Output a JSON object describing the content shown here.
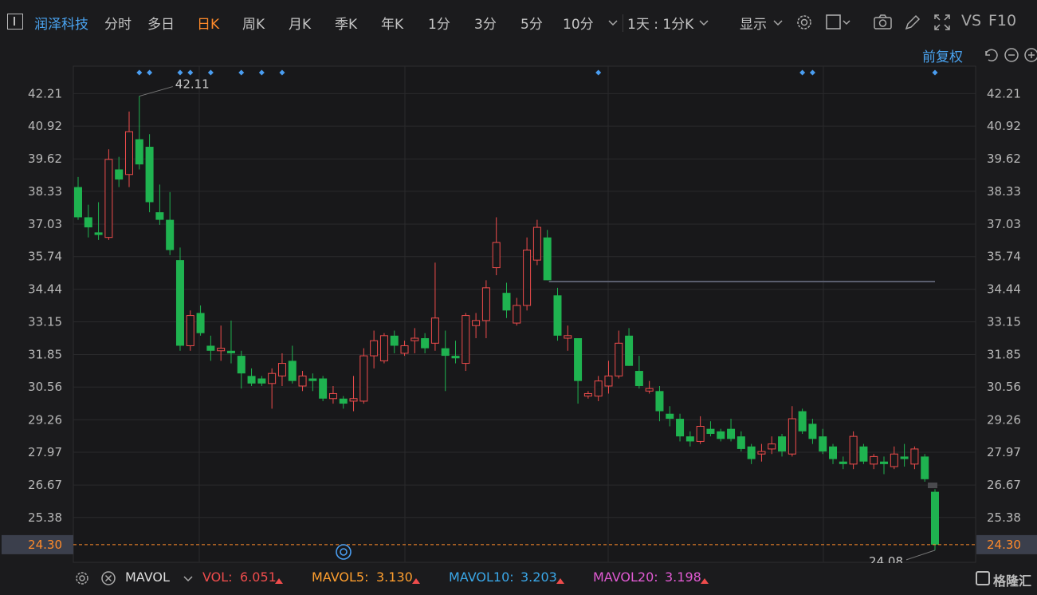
{
  "toolbar": {
    "stock_name": "润泽科技",
    "periods": [
      "分时",
      "多日",
      "日K",
      "周K",
      "月K",
      "季K",
      "年K",
      "1分",
      "3分",
      "5分",
      "10分"
    ],
    "active_period": "日K",
    "interval_select": "1天 : 1分K",
    "display_label": "显示",
    "vs_label": "VS",
    "f10_label": "F10"
  },
  "adjust_label": "前复权",
  "price_highlight_color": "#ff8a2a",
  "up_color": "#ef4c4c",
  "down_color": "#1fb350",
  "chart_data": {
    "type": "candlestick",
    "y_ticks": [
      "42.21",
      "40.92",
      "39.62",
      "38.33",
      "37.03",
      "35.74",
      "34.44",
      "33.15",
      "31.85",
      "30.56",
      "29.26",
      "27.97",
      "26.67",
      "25.38"
    ],
    "ylim": [
      23.6,
      43.3
    ],
    "current_price": "24.30",
    "high_label": "42.11",
    "low_label": "24.08",
    "resistance_level": 34.75,
    "marker_indices": [
      6,
      7,
      10,
      11,
      13,
      16,
      18,
      20,
      51,
      71,
      72,
      84
    ],
    "candles": [
      {
        "o": 38.5,
        "h": 38.9,
        "l": 37.2,
        "c": 37.3
      },
      {
        "o": 37.3,
        "h": 37.8,
        "l": 36.5,
        "c": 36.9
      },
      {
        "o": 36.7,
        "h": 37.9,
        "l": 36.4,
        "c": 36.6
      },
      {
        "o": 36.5,
        "h": 40.0,
        "l": 36.4,
        "c": 39.6
      },
      {
        "o": 39.2,
        "h": 39.7,
        "l": 38.5,
        "c": 38.8
      },
      {
        "o": 39.0,
        "h": 41.5,
        "l": 38.5,
        "c": 40.7
      },
      {
        "o": 40.4,
        "h": 42.11,
        "l": 39.2,
        "c": 39.4
      },
      {
        "o": 40.1,
        "h": 40.6,
        "l": 37.5,
        "c": 37.9
      },
      {
        "o": 37.5,
        "h": 38.6,
        "l": 37.0,
        "c": 37.2
      },
      {
        "o": 37.2,
        "h": 38.3,
        "l": 35.8,
        "c": 36.0
      },
      {
        "o": 35.6,
        "h": 36.1,
        "l": 32.0,
        "c": 32.2
      },
      {
        "o": 32.2,
        "h": 33.6,
        "l": 32.0,
        "c": 33.4
      },
      {
        "o": 33.5,
        "h": 33.8,
        "l": 32.6,
        "c": 32.7
      },
      {
        "o": 32.2,
        "h": 32.6,
        "l": 31.6,
        "c": 32.0
      },
      {
        "o": 32.0,
        "h": 33.0,
        "l": 31.6,
        "c": 32.1
      },
      {
        "o": 32.0,
        "h": 33.2,
        "l": 31.5,
        "c": 31.9
      },
      {
        "o": 31.8,
        "h": 32.0,
        "l": 30.5,
        "c": 31.1
      },
      {
        "o": 31.0,
        "h": 31.3,
        "l": 30.6,
        "c": 30.7
      },
      {
        "o": 30.9,
        "h": 31.0,
        "l": 30.6,
        "c": 30.7
      },
      {
        "o": 30.7,
        "h": 31.3,
        "l": 29.7,
        "c": 31.1
      },
      {
        "o": 31.0,
        "h": 31.9,
        "l": 30.6,
        "c": 31.5
      },
      {
        "o": 31.6,
        "h": 32.2,
        "l": 30.7,
        "c": 30.8
      },
      {
        "o": 30.6,
        "h": 31.2,
        "l": 30.4,
        "c": 31.0
      },
      {
        "o": 30.9,
        "h": 31.1,
        "l": 30.4,
        "c": 30.8
      },
      {
        "o": 30.9,
        "h": 31.0,
        "l": 30.0,
        "c": 30.1
      },
      {
        "o": 30.1,
        "h": 30.6,
        "l": 29.9,
        "c": 30.3
      },
      {
        "o": 30.1,
        "h": 30.2,
        "l": 29.7,
        "c": 29.9
      },
      {
        "o": 30.0,
        "h": 31.0,
        "l": 29.6,
        "c": 30.1
      },
      {
        "o": 30.0,
        "h": 32.1,
        "l": 29.9,
        "c": 31.8
      },
      {
        "o": 31.8,
        "h": 32.8,
        "l": 31.3,
        "c": 32.4
      },
      {
        "o": 31.6,
        "h": 32.7,
        "l": 31.5,
        "c": 32.6
      },
      {
        "o": 32.6,
        "h": 32.8,
        "l": 31.9,
        "c": 32.2
      },
      {
        "o": 31.9,
        "h": 32.4,
        "l": 31.8,
        "c": 32.2
      },
      {
        "o": 32.4,
        "h": 32.9,
        "l": 31.9,
        "c": 32.5
      },
      {
        "o": 32.5,
        "h": 32.7,
        "l": 31.9,
        "c": 32.1
      },
      {
        "o": 32.3,
        "h": 35.5,
        "l": 32.0,
        "c": 33.3
      },
      {
        "o": 32.1,
        "h": 32.8,
        "l": 30.4,
        "c": 31.8
      },
      {
        "o": 31.8,
        "h": 32.4,
        "l": 31.5,
        "c": 31.7
      },
      {
        "o": 31.5,
        "h": 33.5,
        "l": 31.2,
        "c": 33.4
      },
      {
        "o": 33.0,
        "h": 33.5,
        "l": 32.5,
        "c": 33.2
      },
      {
        "o": 33.2,
        "h": 34.8,
        "l": 32.5,
        "c": 34.5
      },
      {
        "o": 35.3,
        "h": 37.3,
        "l": 35.0,
        "c": 36.3
      },
      {
        "o": 34.3,
        "h": 34.7,
        "l": 33.3,
        "c": 33.6
      },
      {
        "o": 33.1,
        "h": 34.1,
        "l": 33.0,
        "c": 33.8
      },
      {
        "o": 33.8,
        "h": 36.5,
        "l": 33.6,
        "c": 36.0
      },
      {
        "o": 35.6,
        "h": 37.2,
        "l": 35.4,
        "c": 36.9
      },
      {
        "o": 36.5,
        "h": 36.8,
        "l": 34.8,
        "c": 34.8
      },
      {
        "o": 34.2,
        "h": 34.5,
        "l": 32.4,
        "c": 32.6
      },
      {
        "o": 32.5,
        "h": 33.0,
        "l": 32.0,
        "c": 32.6
      },
      {
        "o": 32.5,
        "h": 32.5,
        "l": 29.9,
        "c": 30.8
      },
      {
        "o": 30.2,
        "h": 30.4,
        "l": 30.1,
        "c": 30.3
      },
      {
        "o": 30.2,
        "h": 31.0,
        "l": 30.0,
        "c": 30.8
      },
      {
        "o": 30.6,
        "h": 31.6,
        "l": 30.3,
        "c": 31.0
      },
      {
        "o": 31.0,
        "h": 32.8,
        "l": 30.9,
        "c": 32.3
      },
      {
        "o": 32.6,
        "h": 32.9,
        "l": 31.4,
        "c": 31.4
      },
      {
        "o": 31.2,
        "h": 31.8,
        "l": 30.5,
        "c": 30.6
      },
      {
        "o": 30.4,
        "h": 30.8,
        "l": 30.3,
        "c": 30.5
      },
      {
        "o": 30.4,
        "h": 30.6,
        "l": 29.2,
        "c": 29.6
      },
      {
        "o": 29.5,
        "h": 29.8,
        "l": 29.0,
        "c": 29.3
      },
      {
        "o": 29.3,
        "h": 29.5,
        "l": 28.4,
        "c": 28.6
      },
      {
        "o": 28.6,
        "h": 28.8,
        "l": 28.2,
        "c": 28.4
      },
      {
        "o": 28.4,
        "h": 29.4,
        "l": 28.3,
        "c": 29.0
      },
      {
        "o": 28.9,
        "h": 29.2,
        "l": 28.6,
        "c": 28.7
      },
      {
        "o": 28.8,
        "h": 28.9,
        "l": 28.4,
        "c": 28.5
      },
      {
        "o": 28.9,
        "h": 29.3,
        "l": 28.4,
        "c": 28.5
      },
      {
        "o": 28.6,
        "h": 28.8,
        "l": 28.0,
        "c": 28.1
      },
      {
        "o": 28.2,
        "h": 28.3,
        "l": 27.5,
        "c": 27.7
      },
      {
        "o": 27.9,
        "h": 28.3,
        "l": 27.6,
        "c": 28.0
      },
      {
        "o": 28.1,
        "h": 28.6,
        "l": 27.9,
        "c": 28.3
      },
      {
        "o": 28.6,
        "h": 28.7,
        "l": 27.8,
        "c": 28.0
      },
      {
        "o": 27.9,
        "h": 29.8,
        "l": 27.8,
        "c": 29.3
      },
      {
        "o": 29.6,
        "h": 29.7,
        "l": 28.7,
        "c": 28.8
      },
      {
        "o": 29.1,
        "h": 29.3,
        "l": 28.3,
        "c": 28.5
      },
      {
        "o": 28.6,
        "h": 28.9,
        "l": 27.9,
        "c": 28.0
      },
      {
        "o": 28.2,
        "h": 28.3,
        "l": 27.5,
        "c": 27.7
      },
      {
        "o": 27.6,
        "h": 27.8,
        "l": 27.3,
        "c": 27.5
      },
      {
        "o": 27.5,
        "h": 28.8,
        "l": 27.3,
        "c": 28.6
      },
      {
        "o": 28.2,
        "h": 28.3,
        "l": 27.5,
        "c": 27.6
      },
      {
        "o": 27.5,
        "h": 27.9,
        "l": 27.3,
        "c": 27.8
      },
      {
        "o": 27.6,
        "h": 27.8,
        "l": 27.1,
        "c": 27.5
      },
      {
        "o": 27.4,
        "h": 28.2,
        "l": 27.3,
        "c": 27.9
      },
      {
        "o": 27.8,
        "h": 28.3,
        "l": 27.4,
        "c": 27.7
      },
      {
        "o": 27.5,
        "h": 28.2,
        "l": 27.3,
        "c": 28.1
      },
      {
        "o": 27.8,
        "h": 27.9,
        "l": 26.8,
        "c": 26.9
      },
      {
        "o": 26.4,
        "h": 26.5,
        "l": 24.08,
        "c": 24.3
      }
    ]
  },
  "volume_indicator": {
    "name": "MAVOL",
    "vol_label": "VOL:",
    "vol_value": "6.051",
    "ma5_label": "MAVOL5:",
    "ma5_value": "3.130",
    "ma10_label": "MAVOL10:",
    "ma10_value": "3.203",
    "ma20_label": "MAVOL20:",
    "ma20_value": "3.198",
    "vol_color": "#ef4c4c",
    "ma5_color": "#ff9f2e",
    "ma10_color": "#3aa7e8",
    "ma20_color": "#e15ad3"
  },
  "watermark": "格隆汇"
}
